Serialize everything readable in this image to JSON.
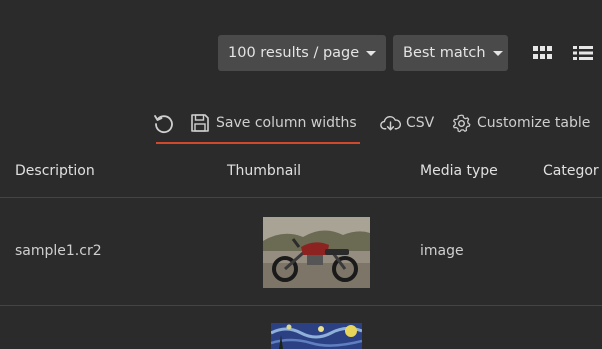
{
  "controls": {
    "per_page": "100 results / page",
    "sort": "Best match"
  },
  "toolbar": {
    "save_widths": "Save column widths",
    "csv": "CSV",
    "customize": "Customize table"
  },
  "table": {
    "headers": [
      "Description",
      "Thumbnail",
      "Media type",
      "Categor"
    ],
    "rows": [
      {
        "description": "sample1.cr2",
        "media_type": "image"
      },
      {
        "description": "",
        "media_type": ""
      }
    ]
  },
  "colors": {
    "background": "#2b2b2b",
    "dropdown": "#4a4a4a",
    "accent_underline": "#d0492f"
  },
  "icons": [
    "reset-icon",
    "save-icon",
    "cloud-download-icon",
    "gear-icon",
    "grid-view-icon",
    "list-view-icon",
    "caret-down-icon"
  ]
}
